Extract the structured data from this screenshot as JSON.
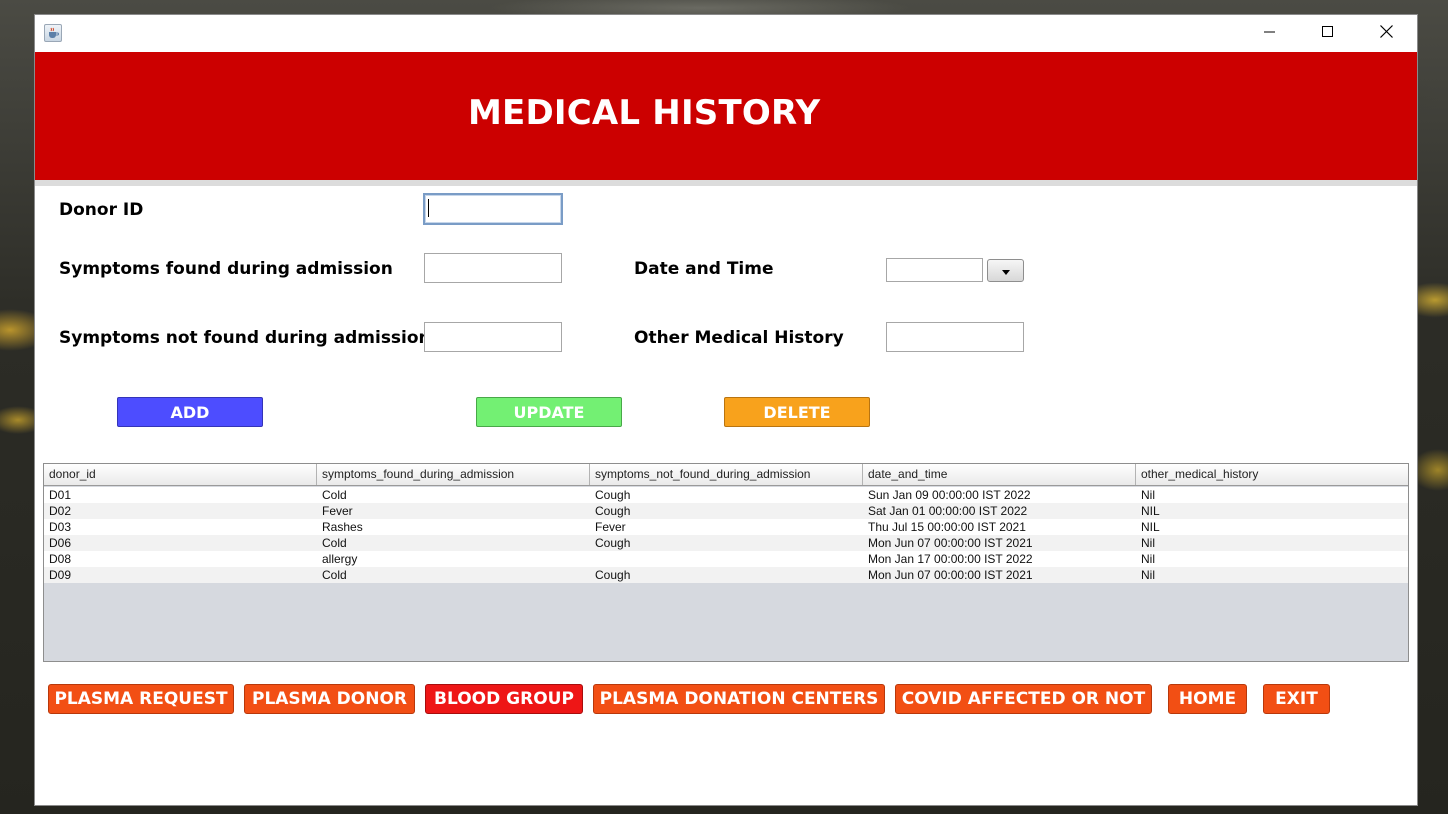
{
  "window": {
    "title": "",
    "controls": {
      "minimize": "minimize-icon",
      "maximize": "maximize-icon",
      "close": "close-icon"
    },
    "app_icon": "java-cup-icon"
  },
  "header": {
    "title": "MEDICAL HISTORY",
    "background": "#cc0000"
  },
  "form": {
    "donor_id": {
      "label": "Donor ID",
      "value": ""
    },
    "symptoms_found": {
      "label": "Symptoms found during admission",
      "value": ""
    },
    "symptoms_not_found": {
      "label": "Symptoms not found during admission",
      "value": ""
    },
    "date_time": {
      "label": "Date and Time",
      "value": ""
    },
    "other_history": {
      "label": "Other Medical History",
      "value": ""
    }
  },
  "actions": {
    "add": {
      "label": "ADD",
      "color": "#4d4dff"
    },
    "update": {
      "label": "UPDATE",
      "color": "#73f073"
    },
    "delete": {
      "label": "DELETE",
      "color": "#f8a21c"
    }
  },
  "table": {
    "columns": [
      "donor_id",
      "symptoms_found_during_admission",
      "symptoms_not_found_during_admission",
      "date_and_time",
      "other_medical_history"
    ],
    "rows": [
      [
        "D01",
        "Cold",
        "Cough",
        "Sun Jan 09 00:00:00 IST 2022",
        "Nil"
      ],
      [
        "D02",
        "Fever",
        "Cough",
        "Sat Jan 01 00:00:00 IST 2022",
        "NIL"
      ],
      [
        "D03",
        "Rashes",
        "Fever",
        "Thu Jul 15 00:00:00 IST 2021",
        "NIL"
      ],
      [
        "D06",
        "Cold",
        "Cough",
        "Mon Jun 07 00:00:00 IST 2021",
        "Nil"
      ],
      [
        "D08",
        "allergy",
        "",
        "Mon Jan 17 00:00:00 IST 2022",
        "Nil"
      ],
      [
        "D09",
        "Cold",
        "Cough",
        "Mon Jun 07 00:00:00 IST 2021",
        "Nil"
      ]
    ]
  },
  "nav": [
    {
      "label": "PLASMA REQUEST",
      "color": "#f24f14"
    },
    {
      "label": "PLASMA DONOR",
      "color": "#f24f14"
    },
    {
      "label": "BLOOD GROUP",
      "color": "#ee1616"
    },
    {
      "label": "PLASMA DONATION CENTERS",
      "color": "#f24f14"
    },
    {
      "label": "COVID AFFECTED OR NOT",
      "color": "#f24f14"
    },
    {
      "label": "HOME",
      "color": "#f24f14"
    },
    {
      "label": "EXIT",
      "color": "#f24f14"
    }
  ]
}
